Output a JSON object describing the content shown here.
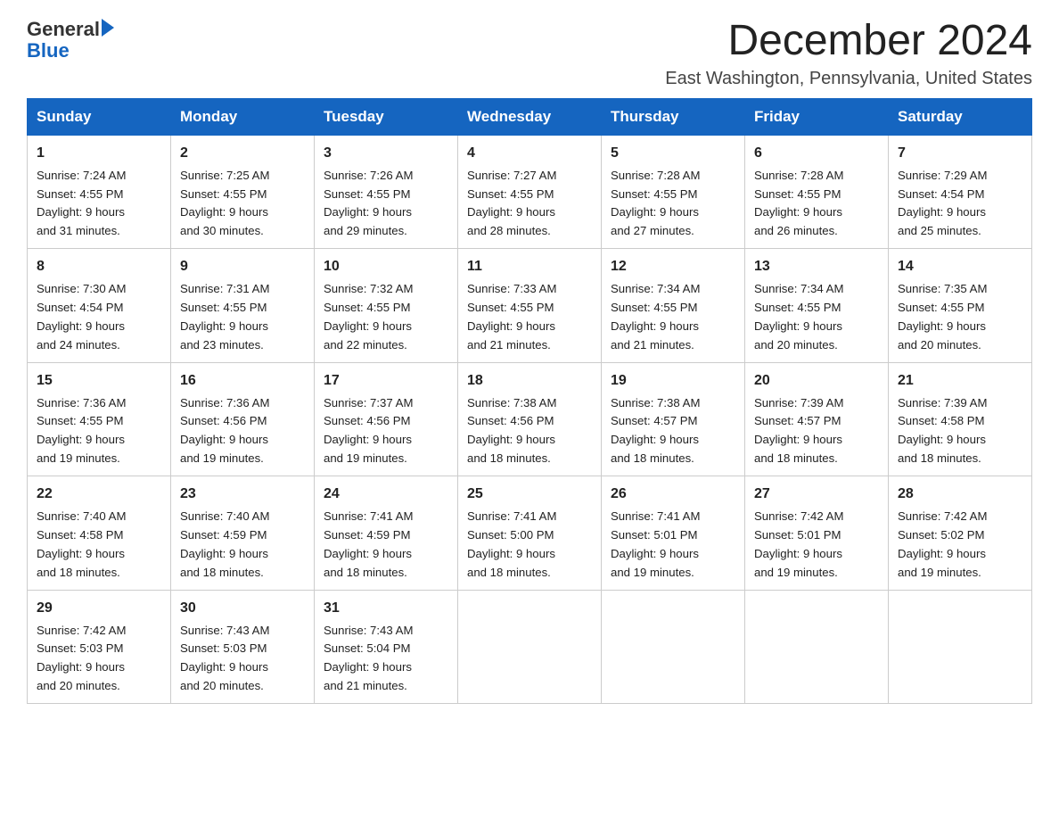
{
  "header": {
    "logo_general": "General",
    "logo_blue": "Blue",
    "month_title": "December 2024",
    "location": "East Washington, Pennsylvania, United States"
  },
  "days_of_week": [
    "Sunday",
    "Monday",
    "Tuesday",
    "Wednesday",
    "Thursday",
    "Friday",
    "Saturday"
  ],
  "weeks": [
    [
      {
        "day": "1",
        "sunrise": "7:24 AM",
        "sunset": "4:55 PM",
        "daylight": "9 hours and 31 minutes."
      },
      {
        "day": "2",
        "sunrise": "7:25 AM",
        "sunset": "4:55 PM",
        "daylight": "9 hours and 30 minutes."
      },
      {
        "day": "3",
        "sunrise": "7:26 AM",
        "sunset": "4:55 PM",
        "daylight": "9 hours and 29 minutes."
      },
      {
        "day": "4",
        "sunrise": "7:27 AM",
        "sunset": "4:55 PM",
        "daylight": "9 hours and 28 minutes."
      },
      {
        "day": "5",
        "sunrise": "7:28 AM",
        "sunset": "4:55 PM",
        "daylight": "9 hours and 27 minutes."
      },
      {
        "day": "6",
        "sunrise": "7:28 AM",
        "sunset": "4:55 PM",
        "daylight": "9 hours and 26 minutes."
      },
      {
        "day": "7",
        "sunrise": "7:29 AM",
        "sunset": "4:54 PM",
        "daylight": "9 hours and 25 minutes."
      }
    ],
    [
      {
        "day": "8",
        "sunrise": "7:30 AM",
        "sunset": "4:54 PM",
        "daylight": "9 hours and 24 minutes."
      },
      {
        "day": "9",
        "sunrise": "7:31 AM",
        "sunset": "4:55 PM",
        "daylight": "9 hours and 23 minutes."
      },
      {
        "day": "10",
        "sunrise": "7:32 AM",
        "sunset": "4:55 PM",
        "daylight": "9 hours and 22 minutes."
      },
      {
        "day": "11",
        "sunrise": "7:33 AM",
        "sunset": "4:55 PM",
        "daylight": "9 hours and 21 minutes."
      },
      {
        "day": "12",
        "sunrise": "7:34 AM",
        "sunset": "4:55 PM",
        "daylight": "9 hours and 21 minutes."
      },
      {
        "day": "13",
        "sunrise": "7:34 AM",
        "sunset": "4:55 PM",
        "daylight": "9 hours and 20 minutes."
      },
      {
        "day": "14",
        "sunrise": "7:35 AM",
        "sunset": "4:55 PM",
        "daylight": "9 hours and 20 minutes."
      }
    ],
    [
      {
        "day": "15",
        "sunrise": "7:36 AM",
        "sunset": "4:55 PM",
        "daylight": "9 hours and 19 minutes."
      },
      {
        "day": "16",
        "sunrise": "7:36 AM",
        "sunset": "4:56 PM",
        "daylight": "9 hours and 19 minutes."
      },
      {
        "day": "17",
        "sunrise": "7:37 AM",
        "sunset": "4:56 PM",
        "daylight": "9 hours and 19 minutes."
      },
      {
        "day": "18",
        "sunrise": "7:38 AM",
        "sunset": "4:56 PM",
        "daylight": "9 hours and 18 minutes."
      },
      {
        "day": "19",
        "sunrise": "7:38 AM",
        "sunset": "4:57 PM",
        "daylight": "9 hours and 18 minutes."
      },
      {
        "day": "20",
        "sunrise": "7:39 AM",
        "sunset": "4:57 PM",
        "daylight": "9 hours and 18 minutes."
      },
      {
        "day": "21",
        "sunrise": "7:39 AM",
        "sunset": "4:58 PM",
        "daylight": "9 hours and 18 minutes."
      }
    ],
    [
      {
        "day": "22",
        "sunrise": "7:40 AM",
        "sunset": "4:58 PM",
        "daylight": "9 hours and 18 minutes."
      },
      {
        "day": "23",
        "sunrise": "7:40 AM",
        "sunset": "4:59 PM",
        "daylight": "9 hours and 18 minutes."
      },
      {
        "day": "24",
        "sunrise": "7:41 AM",
        "sunset": "4:59 PM",
        "daylight": "9 hours and 18 minutes."
      },
      {
        "day": "25",
        "sunrise": "7:41 AM",
        "sunset": "5:00 PM",
        "daylight": "9 hours and 18 minutes."
      },
      {
        "day": "26",
        "sunrise": "7:41 AM",
        "sunset": "5:01 PM",
        "daylight": "9 hours and 19 minutes."
      },
      {
        "day": "27",
        "sunrise": "7:42 AM",
        "sunset": "5:01 PM",
        "daylight": "9 hours and 19 minutes."
      },
      {
        "day": "28",
        "sunrise": "7:42 AM",
        "sunset": "5:02 PM",
        "daylight": "9 hours and 19 minutes."
      }
    ],
    [
      {
        "day": "29",
        "sunrise": "7:42 AM",
        "sunset": "5:03 PM",
        "daylight": "9 hours and 20 minutes."
      },
      {
        "day": "30",
        "sunrise": "7:43 AM",
        "sunset": "5:03 PM",
        "daylight": "9 hours and 20 minutes."
      },
      {
        "day": "31",
        "sunrise": "7:43 AM",
        "sunset": "5:04 PM",
        "daylight": "9 hours and 21 minutes."
      },
      null,
      null,
      null,
      null
    ]
  ],
  "labels": {
    "sunrise": "Sunrise:",
    "sunset": "Sunset:",
    "daylight": "Daylight:"
  }
}
